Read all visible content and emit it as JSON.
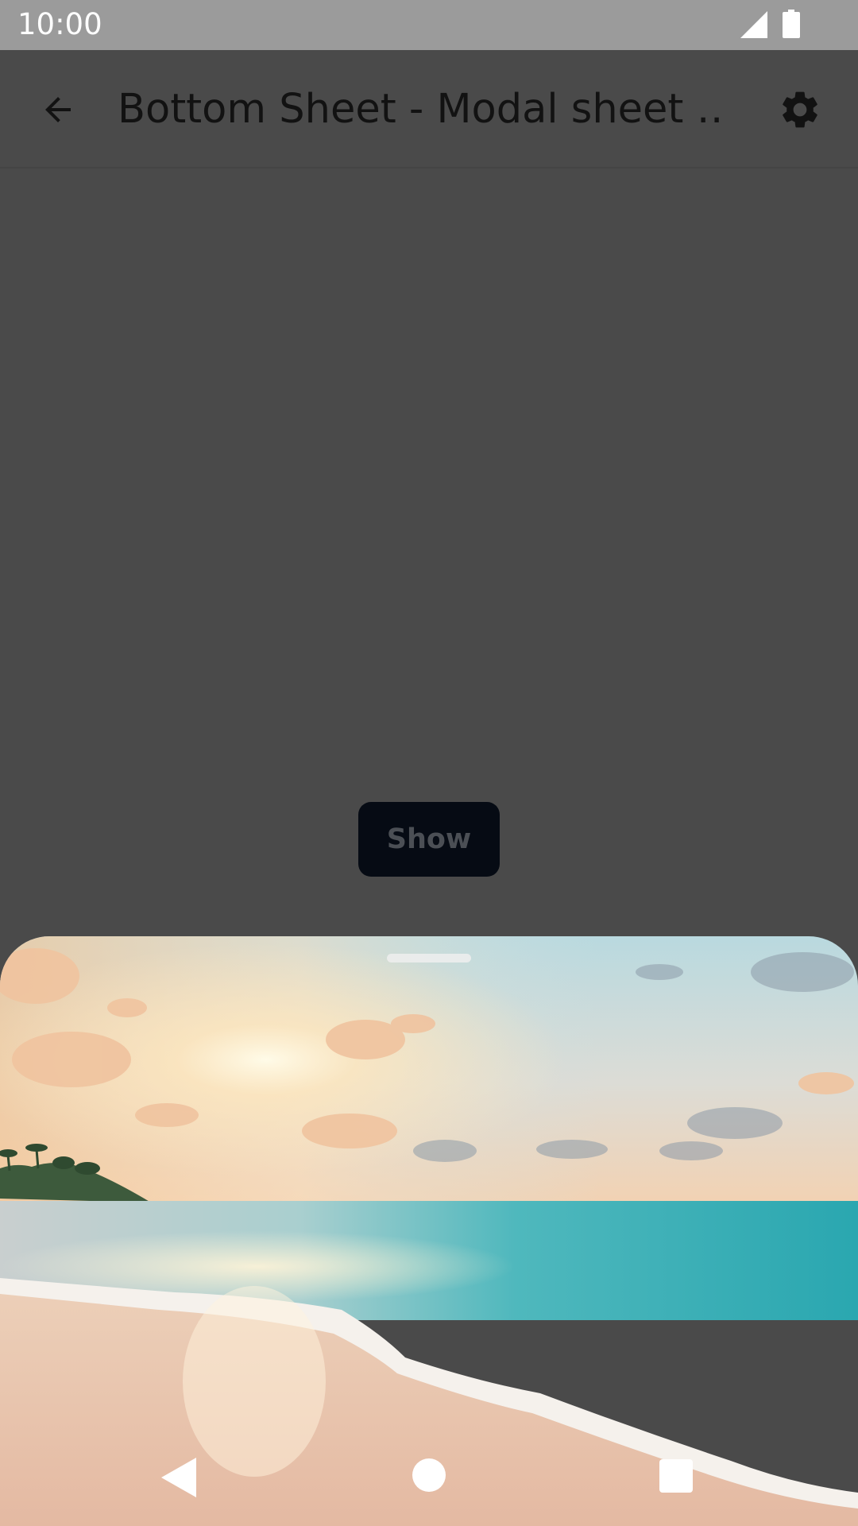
{
  "status_bar": {
    "time": "10:00",
    "signal_icon": "cell-signal-icon",
    "battery_icon": "battery-icon"
  },
  "app_bar": {
    "title": "Bottom Sheet - Modal sheet …",
    "back_icon": "arrow-back-icon",
    "settings_icon": "gear-icon"
  },
  "main": {
    "show_button_label": "Show"
  },
  "bottom_sheet": {
    "image": "beach-sunset-photo",
    "handle": "drag-handle"
  },
  "nav_bar": {
    "back_icon": "nav-back-triangle-icon",
    "home_icon": "nav-home-circle-icon",
    "recents_icon": "nav-recents-square-icon"
  },
  "colors": {
    "scrim": "#4a4a4a",
    "status_bar": "#9b9b9b",
    "button_bg": "#060b14"
  }
}
